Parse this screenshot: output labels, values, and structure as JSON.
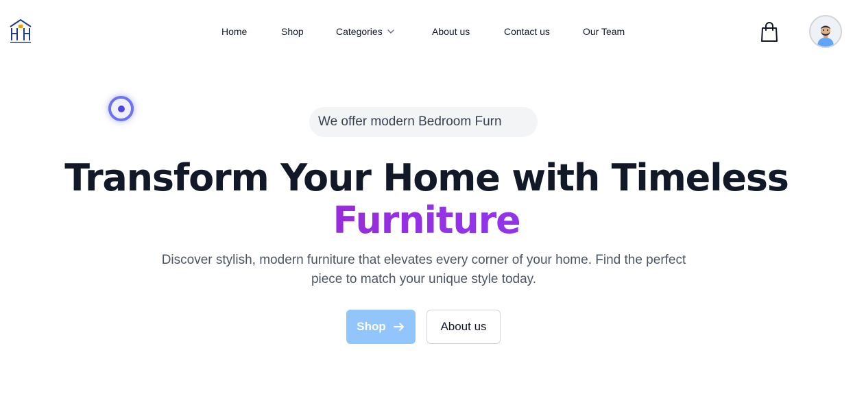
{
  "nav": {
    "logo_icon": "chair-logo-icon",
    "links": [
      {
        "label": "Home"
      },
      {
        "label": "Shop"
      },
      {
        "label": "Categories",
        "icon": "chevron-down-icon"
      },
      {
        "label": "About us"
      },
      {
        "label": "Contact us"
      },
      {
        "label": "Our Team"
      }
    ],
    "cart_icon": "shopping-bag-icon",
    "avatar_icon": "user-avatar-icon"
  },
  "hero": {
    "badge_text": "We offer modern Bedroom Furn",
    "headline_line1": "Transform Your Home with Timeless",
    "headline_line2": "Furniture",
    "subtext": "Discover stylish, modern furniture that elevates every corner of your home. Find the perfect piece to match your unique style today.",
    "shop_button": "Shop",
    "shop_button_icon": "arrow-right-icon",
    "about_button": "About us"
  },
  "colors": {
    "headline": "#111827",
    "accent_gradient_start": "#a21caf",
    "accent_gradient_end": "#7c3aed",
    "shop_button_bg": "#93c5fd",
    "indicator": "#4f46e5"
  }
}
